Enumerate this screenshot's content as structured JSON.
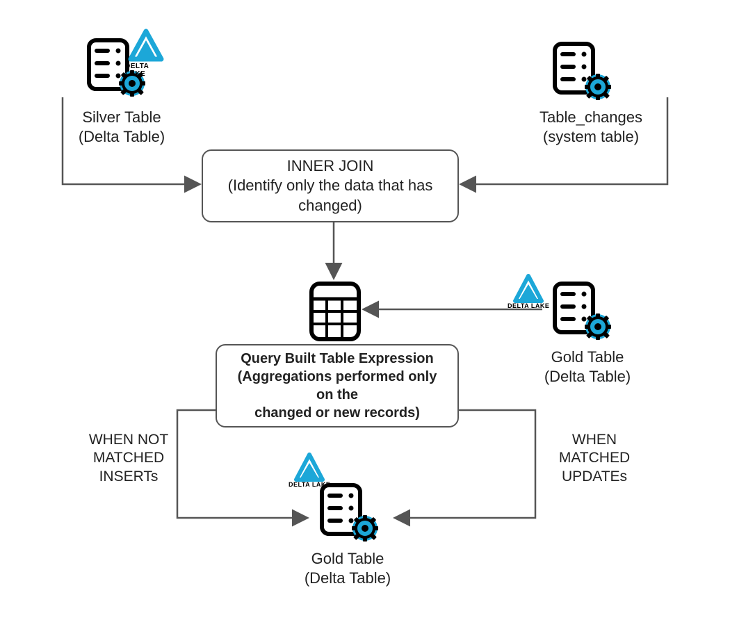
{
  "nodes": {
    "silver": {
      "line1": "Silver Table",
      "line2": "(Delta Table)"
    },
    "changes": {
      "line1": "Table_changes",
      "line2": "(system table)"
    },
    "gold_src": {
      "line1": "Gold Table",
      "line2": "(Delta Table)"
    },
    "gold_sink": {
      "line1": "Gold Table",
      "line2": "(Delta Table)"
    }
  },
  "boxes": {
    "join": {
      "line1": "INNER JOIN",
      "line2": "(Identify only the data that has",
      "line3": "changed)"
    },
    "query": {
      "line1": "Query Built Table Expression",
      "line2": "(Aggregations performed only on the",
      "line3": "changed or new records)"
    }
  },
  "edge_labels": {
    "left": {
      "line1": "WHEN NOT",
      "line2": "MATCHED",
      "line3": "INSERTs"
    },
    "right": {
      "line1": "WHEN",
      "line2": "MATCHED",
      "line3": "UPDATEs"
    }
  },
  "delta_lake_text": "DELTA LAKE",
  "colors": {
    "accent": "#1ca7d8",
    "stroke": "#555555"
  }
}
